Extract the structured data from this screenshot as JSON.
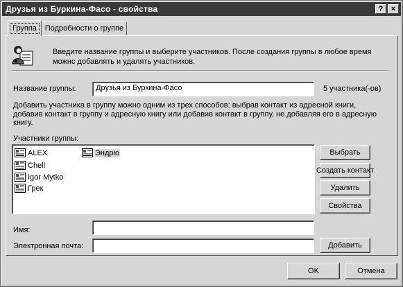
{
  "window": {
    "title": "Друзья из Буркина-Фасо - свойства",
    "help_btn": "?",
    "close_btn": "×"
  },
  "tabs": [
    {
      "label": "Группа",
      "active": true
    },
    {
      "label": "Подробности о группе",
      "active": false
    }
  ],
  "intro": {
    "line1": "Введите название группы и выберите участников. После создания группы в любое время",
    "line2": "можнс добавлять и удалять участников.",
    "icon": "group-people-icon"
  },
  "group_name": {
    "label": "Название группы:",
    "value": "Друзья из Буркина-Фасо",
    "count": "5 участника(-ов)"
  },
  "description": {
    "line1": "Добавить участника в группу можно одним из трех способов: выбрав контакт из адресной книги,",
    "line2": "добавив контакт в группу и адресную книгу или добавив контакт в группу, не добавляя его в адресную",
    "line3": "книгу."
  },
  "members": {
    "label": "Участники группы:",
    "items": [
      {
        "name": "ALEX",
        "icon": "contact-card-icon"
      },
      {
        "name": "Chell",
        "icon": "contact-card-icon"
      },
      {
        "name": "Igor Mytko",
        "icon": "contact-card-icon"
      },
      {
        "name": "Грек",
        "icon": "contact-card-icon"
      },
      {
        "name": "Эндрю",
        "icon": "contact-card-icon",
        "selected": true
      }
    ]
  },
  "side_buttons": {
    "select": "Выбрать",
    "create_contact": "Создать контакт",
    "delete": "Удалить",
    "properties": "Свойства",
    "add": "Добавить"
  },
  "new_contact": {
    "name_label": "Имя:",
    "name_value": "",
    "email_label": "Электронная почта:",
    "email_value": ""
  },
  "dialog_buttons": {
    "ok": "OK",
    "cancel": "Отмена"
  }
}
